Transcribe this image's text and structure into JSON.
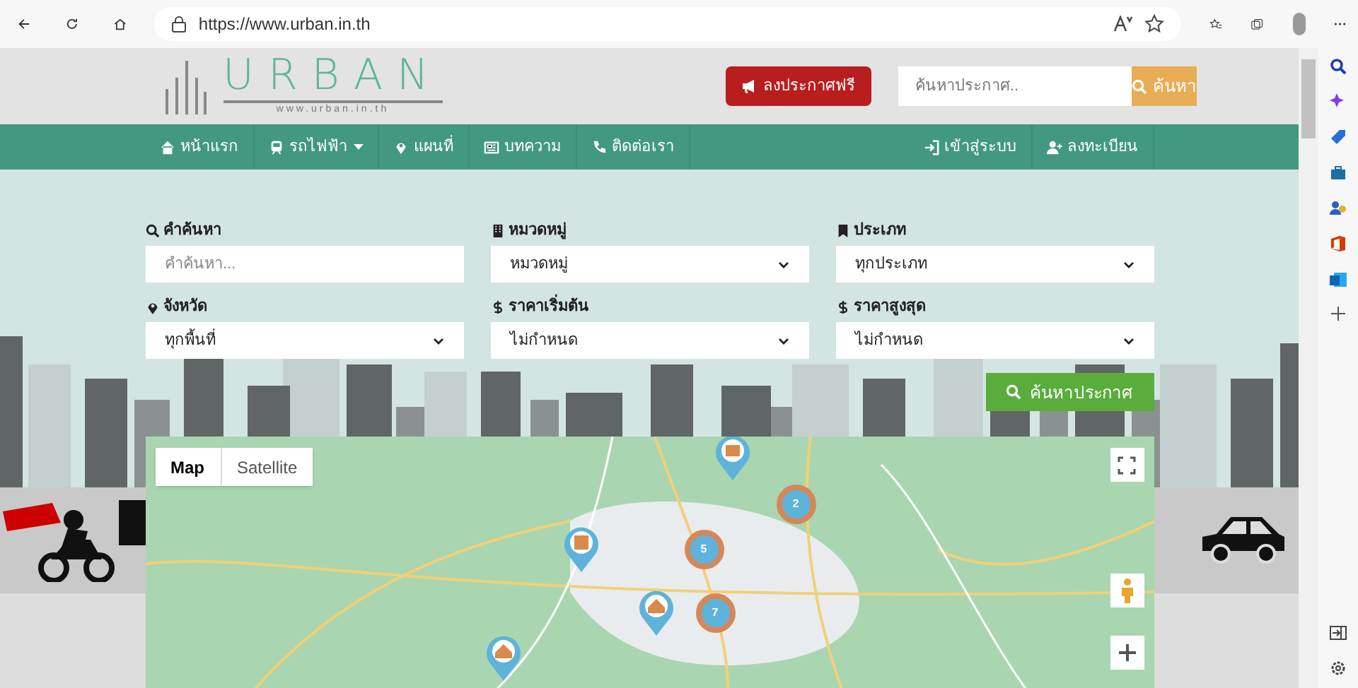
{
  "browser": {
    "url": "https://www.urban.in.th"
  },
  "header": {
    "logo": {
      "name": "URBAN",
      "tagline": "www.urban.in.th"
    },
    "post_button": "ลงประกาศฟรี",
    "search": {
      "placeholder": "ค้นหาประกาศ..",
      "button": "ค้นหา"
    }
  },
  "nav": {
    "left": [
      {
        "label": "หน้าแรก",
        "kind": "home",
        "dropdown": false
      },
      {
        "label": "รถไฟฟ้า",
        "kind": "train",
        "dropdown": true
      },
      {
        "label": "แผนที่",
        "kind": "pin",
        "dropdown": false
      },
      {
        "label": "บทความ",
        "kind": "news",
        "dropdown": false
      },
      {
        "label": "ติดต่อเรา",
        "kind": "phone",
        "dropdown": false
      }
    ],
    "right": [
      {
        "label": "เข้าสู่ระบบ",
        "kind": "login",
        "dropdown": false
      },
      {
        "label": "ลงทะเบียน",
        "kind": "user",
        "dropdown": false
      }
    ]
  },
  "filters": [
    {
      "label": "คำค้นหา",
      "kind": "text",
      "placeholder": "คำค้นหา..."
    },
    {
      "label": "หมวดหมู่",
      "kind": "select",
      "value": "หมวดหมู่"
    },
    {
      "label": "ประเภท",
      "kind": "select",
      "value": "ทุกประเภท"
    },
    {
      "label": "จังหวัด",
      "kind": "select",
      "value": "ทุกพื้นที่"
    },
    {
      "label": "ราคาเริ่มต้น",
      "kind": "select",
      "value": "ไม่กำหนด"
    },
    {
      "label": "ราคาสูงสุด",
      "kind": "select",
      "value": "ไม่กำหนด"
    }
  ],
  "search_button": "ค้นหาประกาศ",
  "map": {
    "type_buttons": [
      {
        "label": "Map",
        "selected": true
      },
      {
        "label": "Satellite",
        "selected": false
      }
    ],
    "clusters": [
      {
        "count": "2"
      },
      {
        "count": "5"
      },
      {
        "count": "7"
      }
    ]
  }
}
